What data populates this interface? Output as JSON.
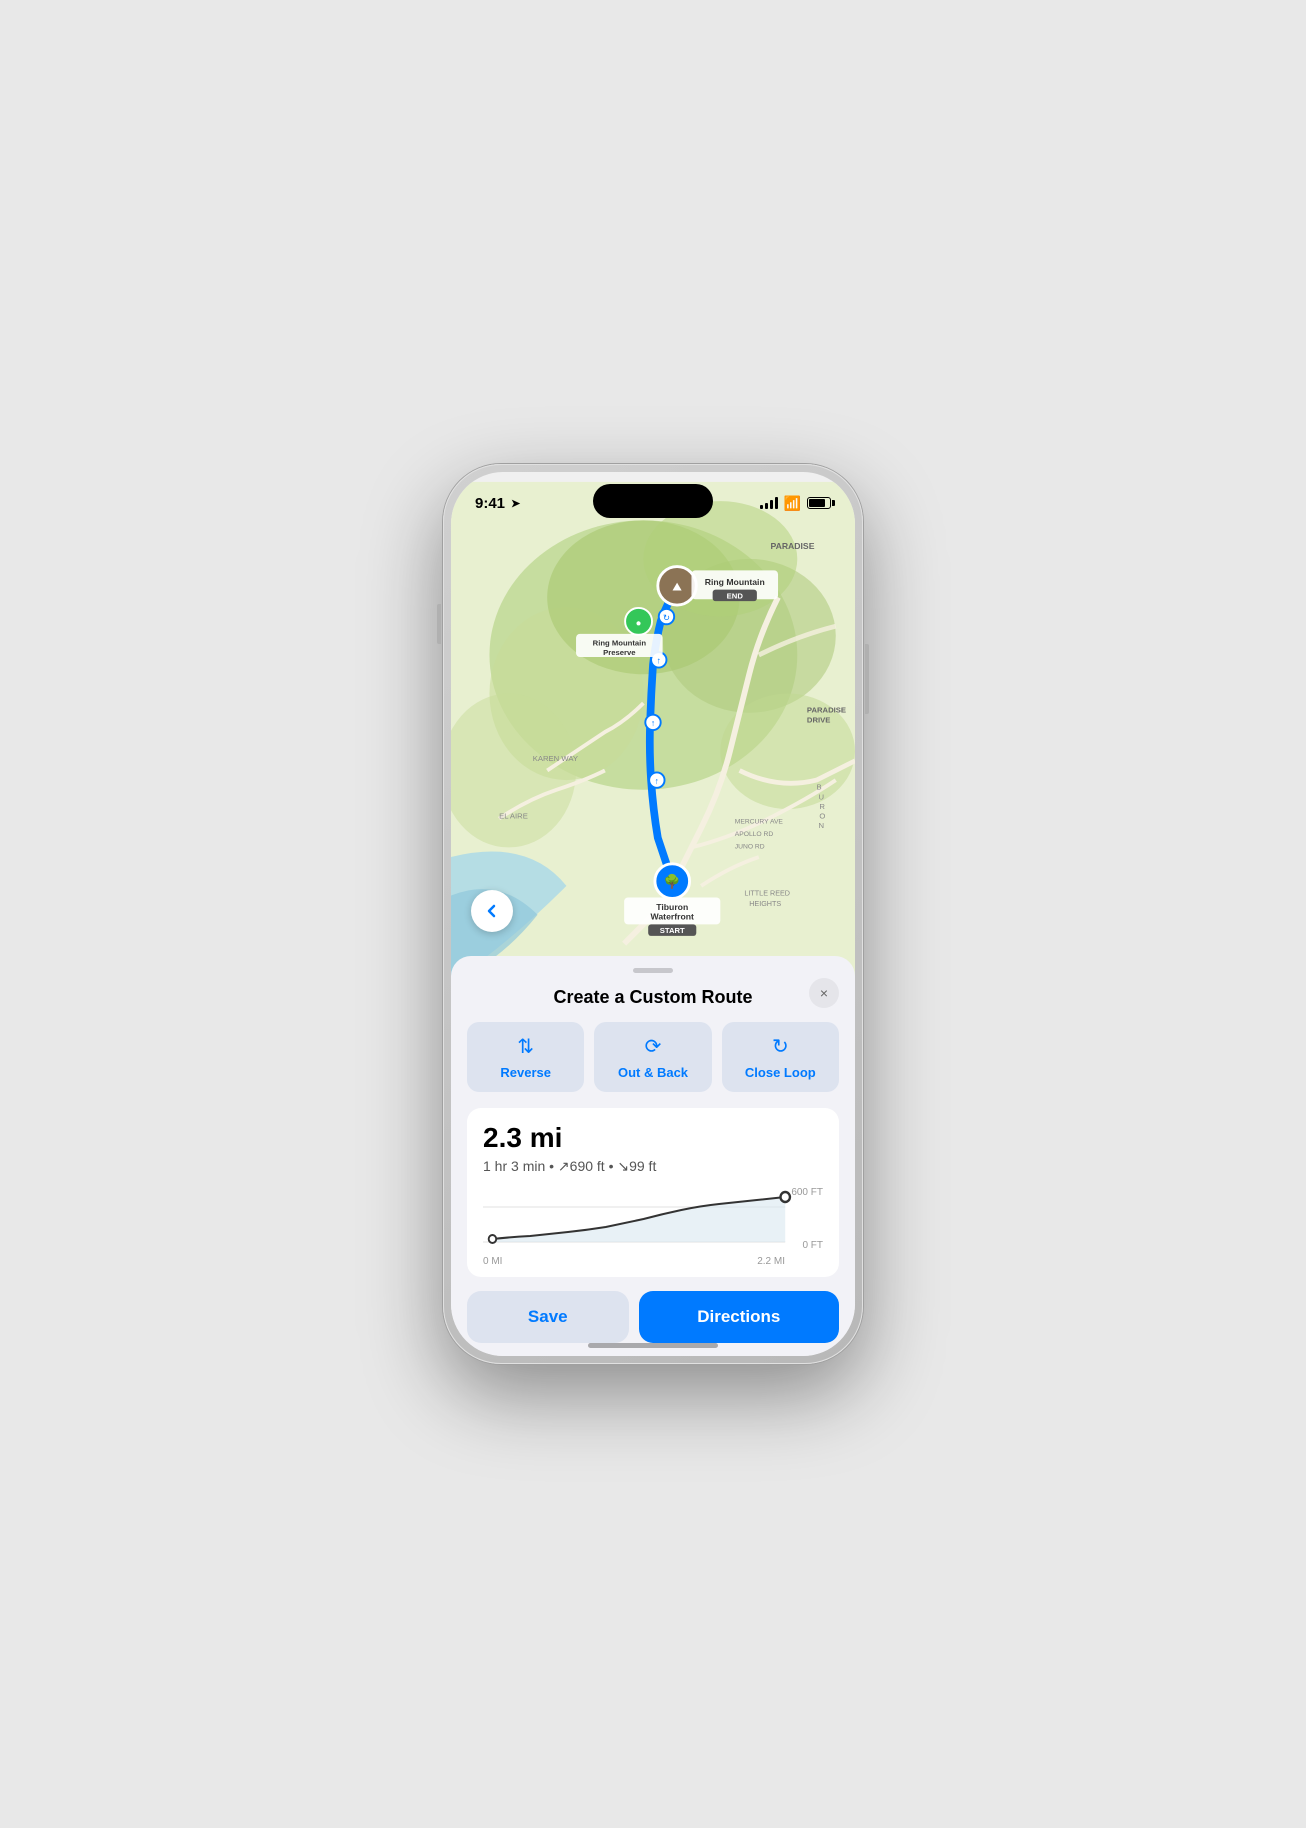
{
  "statusBar": {
    "time": "9:41",
    "locationArrow": true
  },
  "map": {
    "locations": {
      "start": "Tiburon Waterfront",
      "startLabel": "START",
      "end": "Ring Mountain",
      "endLabel": "END",
      "preserve": "Ring Mountain Preserve",
      "paradise": "PARADISE",
      "paradiseDrive": "PARADISE DRIVE",
      "karenWay": "KAREN WAY",
      "elAire": "EL AIRE",
      "mercuryAve": "MERCURY AVE",
      "apolloRd": "APOLLO RD",
      "junoRd": "JUNO RD",
      "littleReedHeights": "LITTLE REED HEIGHTS",
      "buron": "B U R O N"
    }
  },
  "bottomSheet": {
    "title": "Create a Custom Route",
    "closeLabel": "×",
    "actions": [
      {
        "icon": "⇅",
        "label": "Reverse"
      },
      {
        "icon": "↺",
        "label": "Out & Back"
      },
      {
        "icon": "↻",
        "label": "Close Loop"
      }
    ],
    "distance": "2.3 mi",
    "time": "1 hr 3 min",
    "elevationUp": "↗690 ft",
    "elevationDown": "↘99 ft",
    "detailsText": "1 hr 3 min • ↗690 ft • ↘99 ft",
    "chart": {
      "yMax": "600 FT",
      "yMin": "0 FT",
      "xStart": "0 MI",
      "xEnd": "2.2 MI"
    },
    "saveLabel": "Save",
    "directionsLabel": "Directions"
  }
}
